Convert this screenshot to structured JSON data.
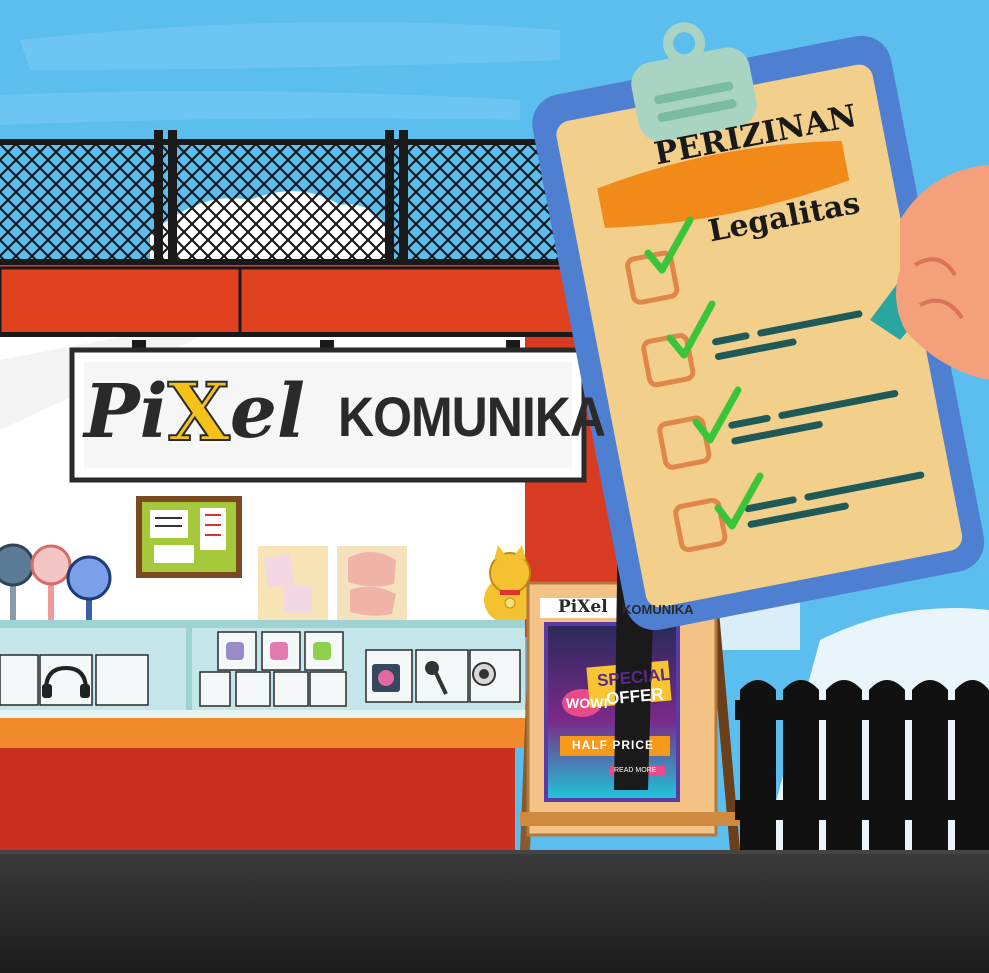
{
  "shop_sign": {
    "brand_part1": "Pi",
    "brand_x": "X",
    "brand_part2": "el",
    "name": "KOMUNIKA"
  },
  "clipboard": {
    "banner_label": "PERIZINAN",
    "heading": "Legalitas"
  },
  "easel_board": {
    "mini_brand": "PiXel",
    "mini_name": "KOMUNIKA",
    "wow_badge": "WOW!",
    "special_line": "SPECIAL",
    "offer_line": "OFFER",
    "half_price": "HALF PRICE",
    "read_more": "READ MORE"
  },
  "colors": {
    "sky": "#5cbdef",
    "kiosk_red": "#d93a22",
    "counter_orange": "#f08a2c",
    "clipboard_board": "#4f7fd0",
    "clipboard_paper": "#f3cf8c",
    "banner_orange": "#f28a1a",
    "check_green": "#3ac43a",
    "board_purple": "#5a3aa8",
    "road": "#262626"
  },
  "icons": [
    "fan-icon",
    "headphones-icon",
    "earbuds-icon",
    "camera-icon",
    "microphone-icon",
    "lucky-cat-icon",
    "pencil-icon",
    "checkmark-icon"
  ]
}
